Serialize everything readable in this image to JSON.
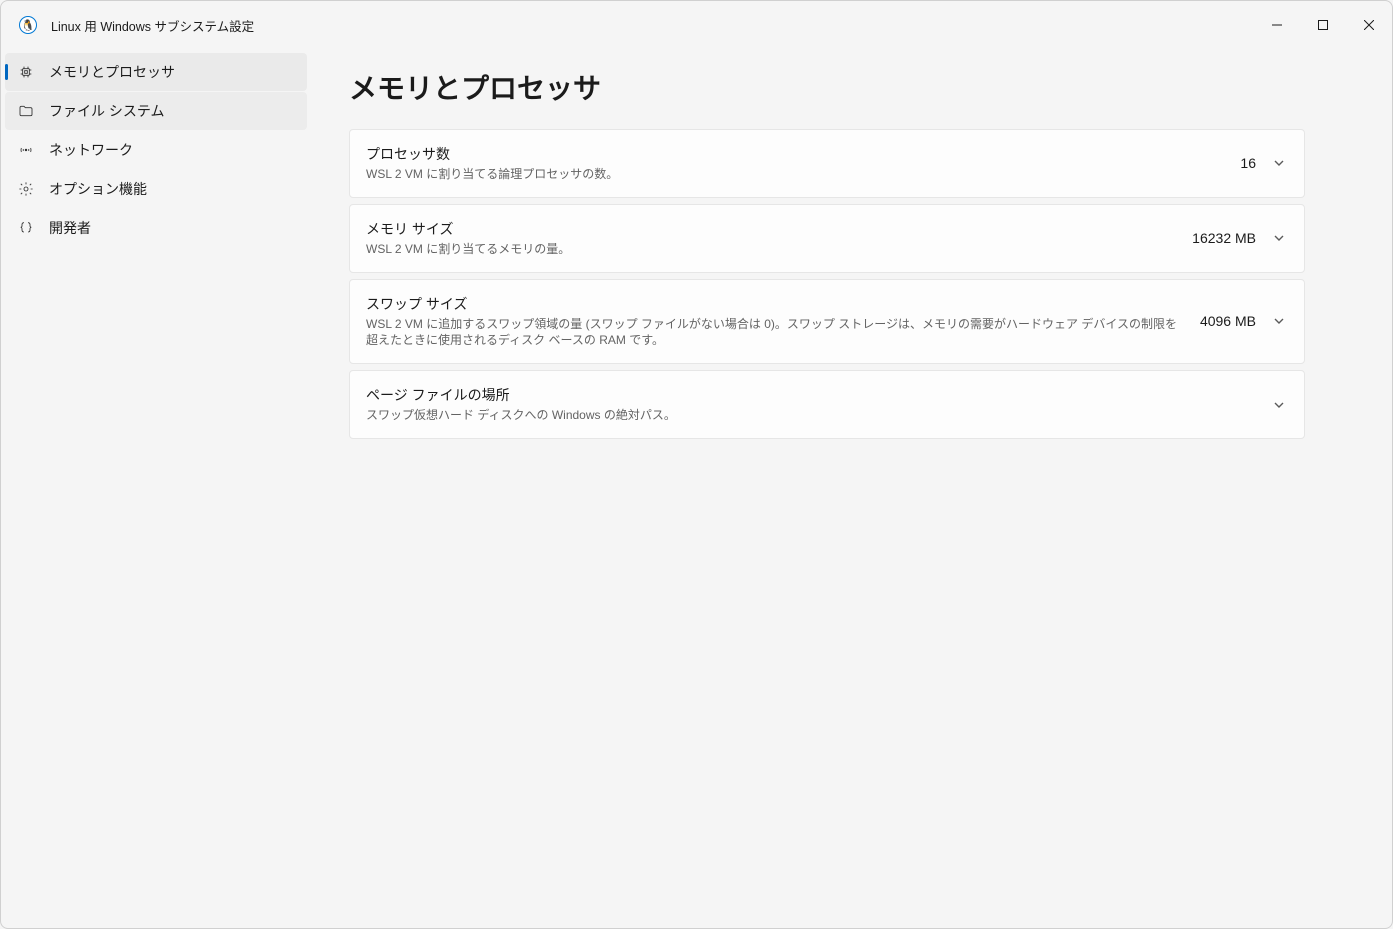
{
  "window": {
    "title": "Linux 用 Windows サブシステム設定"
  },
  "sidebar": {
    "items": [
      {
        "icon": "cpu",
        "label": "メモリとプロセッサ",
        "state": "active"
      },
      {
        "icon": "folder",
        "label": "ファイル システム",
        "state": "hover"
      },
      {
        "icon": "broadcast",
        "label": "ネットワーク",
        "state": ""
      },
      {
        "icon": "gear",
        "label": "オプション機能",
        "state": ""
      },
      {
        "icon": "braces",
        "label": "開発者",
        "state": ""
      }
    ]
  },
  "page": {
    "title": "メモリとプロセッサ",
    "settings": [
      {
        "title": "プロセッサ数",
        "desc": "WSL 2 VM に割り当てる論理プロセッサの数。",
        "value": "16"
      },
      {
        "title": "メモリ サイズ",
        "desc": "WSL 2 VM に割り当てるメモリの量。",
        "value": "16232 MB"
      },
      {
        "title": "スワップ サイズ",
        "desc": "WSL 2 VM に追加するスワップ領域の量 (スワップ ファイルがない場合は 0)。スワップ ストレージは、メモリの需要がハードウェア デバイスの制限を超えたときに使用されるディスク ベースの RAM です。",
        "value": "4096 MB"
      },
      {
        "title": "ページ ファイルの場所",
        "desc": "スワップ仮想ハード ディスクへの Windows の絶対パス。",
        "value": ""
      }
    ]
  }
}
